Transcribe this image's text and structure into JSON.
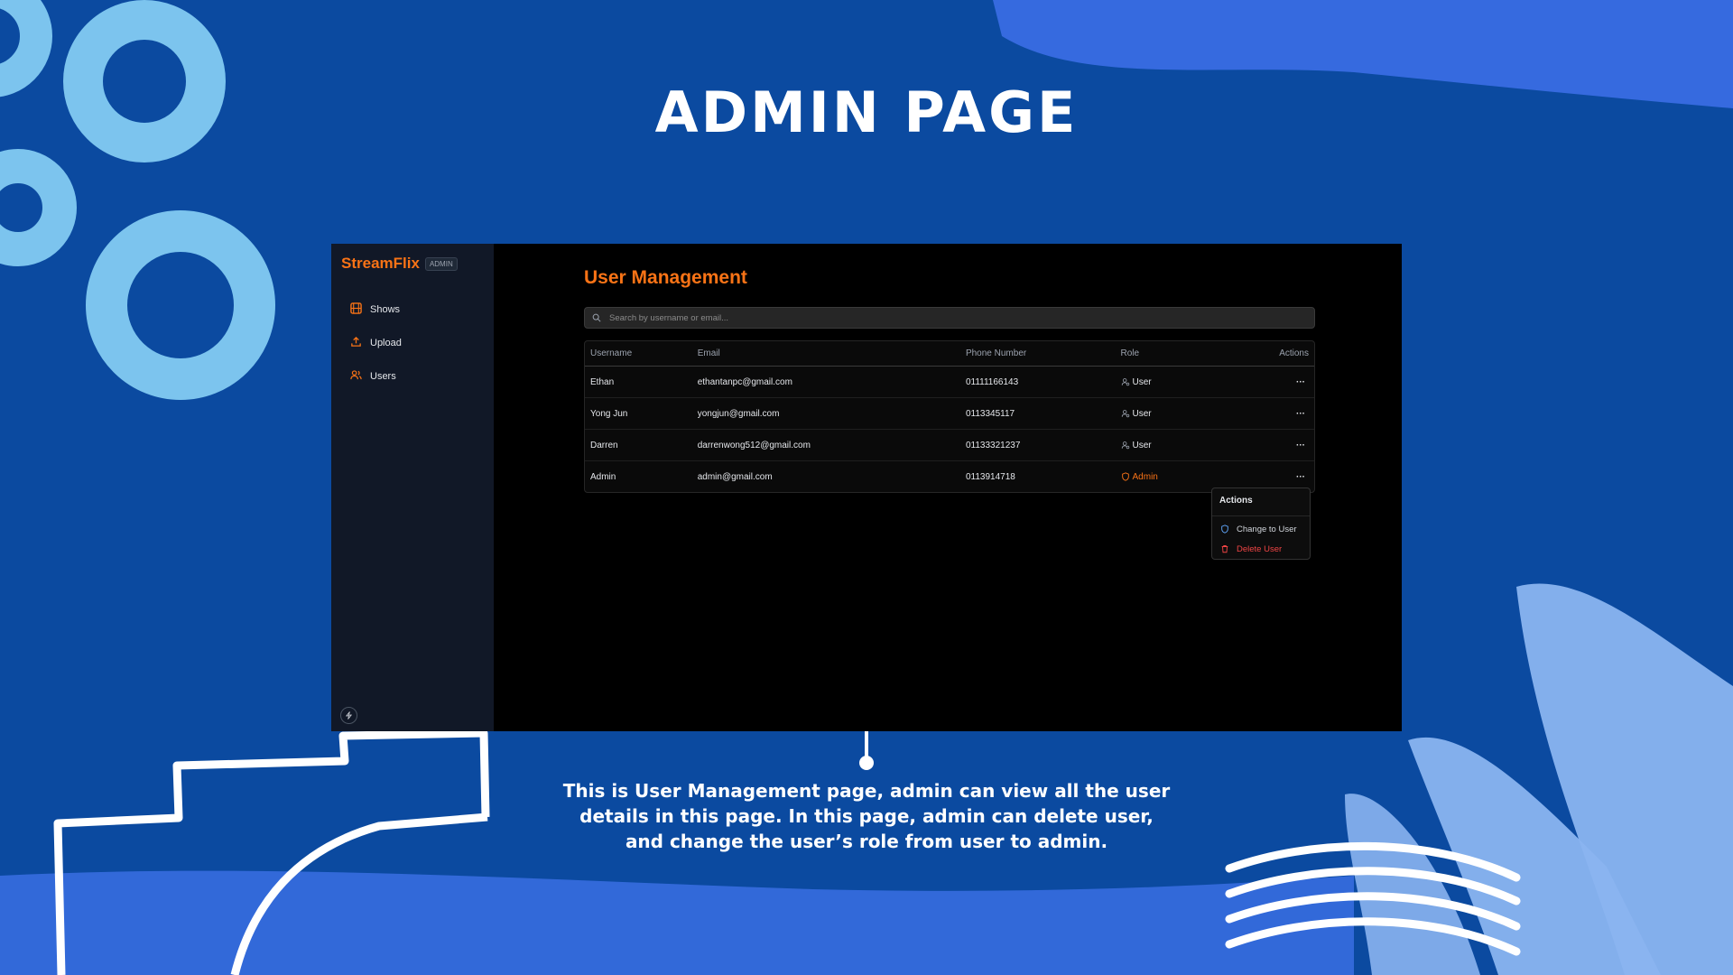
{
  "slide": {
    "title": "ADMIN PAGE",
    "caption": "This is User Management page, admin can view all the user details in this page. In this page, admin can delete user, and change the user’s role from user to admin."
  },
  "app": {
    "brand": "StreamFlix",
    "badge": "ADMIN",
    "nav": [
      {
        "label": "Shows",
        "icon": "film-icon"
      },
      {
        "label": "Upload",
        "icon": "upload-icon"
      },
      {
        "label": "Users",
        "icon": "users-icon"
      }
    ],
    "footer_icon": "lightning-icon",
    "page_title": "User Management",
    "search": {
      "placeholder": "Search by username or email..."
    },
    "table": {
      "columns": [
        "Username",
        "Email",
        "Phone Number",
        "Role",
        "Actions"
      ],
      "rows": [
        {
          "username": "Ethan",
          "email": "ethantanpc@gmail.com",
          "phone": "01111166143",
          "role": "User",
          "action": "···"
        },
        {
          "username": "Yong Jun",
          "email": "yongjun@gmail.com",
          "phone": "0113345117",
          "role": "User",
          "action": "···"
        },
        {
          "username": "Darren",
          "email": "darrenwong512@gmail.com",
          "phone": "01133321237",
          "role": "User",
          "action": "···"
        },
        {
          "username": "Admin",
          "email": "admin@gmail.com",
          "phone": "0113914718",
          "role": "Admin",
          "action": "···"
        }
      ]
    },
    "actions_menu": {
      "title": "Actions",
      "items": [
        {
          "label": "Change to User",
          "icon": "shield-icon"
        },
        {
          "label": "Delete User",
          "icon": "trash-icon"
        }
      ]
    }
  },
  "colors": {
    "accent": "#f97316",
    "background": "#0b4aa0",
    "danger": "#ef4444"
  }
}
